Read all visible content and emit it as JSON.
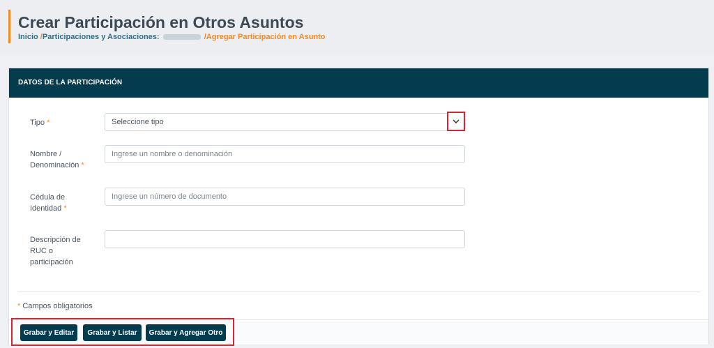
{
  "page": {
    "title": "Crear Participación en Otros Asuntos",
    "breadcrumb": {
      "home": "Inicio",
      "sep1": "/",
      "section": "Participaciones y Asociaciones",
      "section_suffix": ":",
      "sep2": "/",
      "current": "Agregar Participación en Asunto"
    }
  },
  "card": {
    "header": "DATOS DE LA PARTICIPACIÓN",
    "fields": {
      "tipo": {
        "label": "Tipo",
        "value": "Seleccione tipo",
        "required_mark": "*"
      },
      "nombre": {
        "label": "Nombre / Denominación",
        "placeholder": "Ingrese un nombre o denominación",
        "required_mark": "*"
      },
      "cedula": {
        "label": "Cédula de Identidad",
        "placeholder": "Ingrese un número de documento",
        "required_mark": "*"
      },
      "descripcion": {
        "label": "Descripción de RUC o participación",
        "placeholder": ""
      }
    },
    "footnote": {
      "mark": "*",
      "text": "Campos obligatorios"
    },
    "buttons": {
      "grabar_editar": "Grabar y Editar",
      "grabar_listar": "Grabar y Listar",
      "grabar_agregar": "Grabar y Agregar Otro"
    }
  },
  "colors": {
    "primary": "#033b4f",
    "accent": "#f08a24",
    "highlight": "#d9262e"
  },
  "icons": {
    "select_chevron": "chevron-down-icon"
  }
}
